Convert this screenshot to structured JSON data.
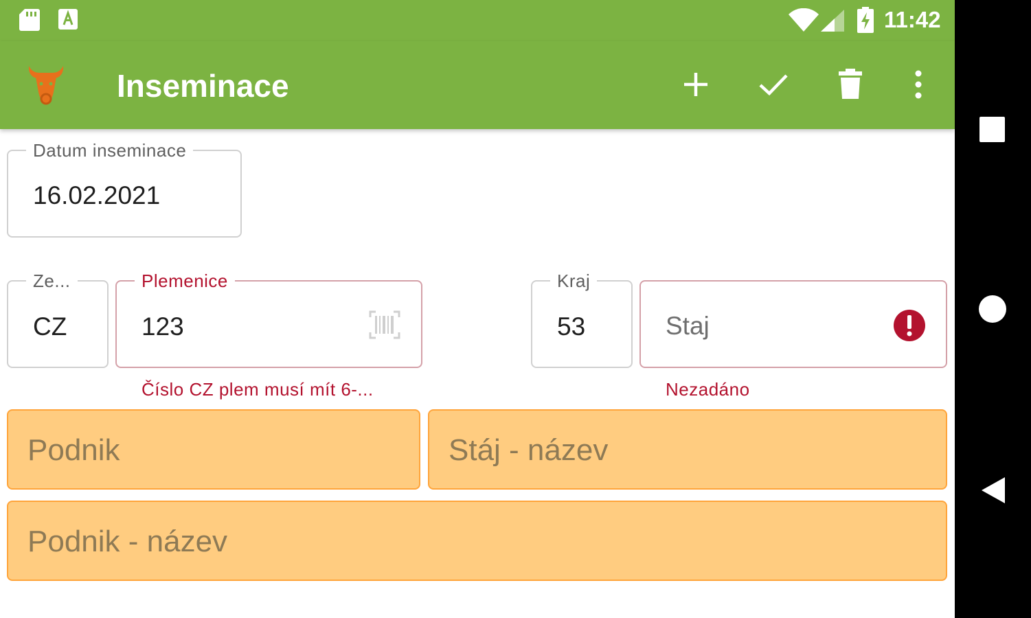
{
  "status_bar": {
    "time": "11:42"
  },
  "app_bar": {
    "title": "Inseminace",
    "actions": [
      "add-icon",
      "check-icon",
      "delete-icon",
      "more-vert-icon"
    ],
    "color": "#7cb342",
    "logo": "bull-head-icon"
  },
  "form": {
    "date": {
      "label": "Datum inseminace",
      "value": "16.02.2021"
    },
    "country": {
      "label": "Ze...",
      "value": "CZ"
    },
    "bull": {
      "label": "Plemenice",
      "value": "123",
      "error": "Číslo CZ plem musí mít 6-..."
    },
    "region": {
      "label": "Kraj",
      "value": "53"
    },
    "stable": {
      "placeholder": "Staj",
      "error": "Nezadáno"
    },
    "company": {
      "placeholder": "Podnik"
    },
    "stable_name": {
      "placeholder": "Stáj - název"
    },
    "company_name": {
      "placeholder": "Podnik - název"
    }
  },
  "colors": {
    "error": "#b3122e",
    "highlight": "#ffcc80",
    "highlight_border": "#ffa43a"
  },
  "nav_bar": {
    "buttons": [
      "recents-icon",
      "home-icon",
      "back-icon"
    ]
  }
}
